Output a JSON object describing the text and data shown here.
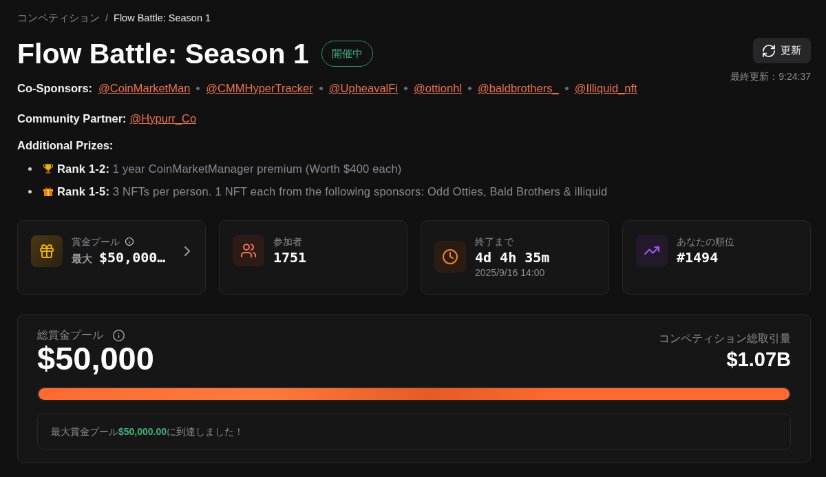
{
  "breadcrumb": {
    "parent": "コンペティション",
    "separator": "/",
    "current": "Flow Battle: Season 1"
  },
  "header": {
    "title": "Flow Battle: Season 1",
    "status": "開催中",
    "refresh_button": "更新",
    "last_updated": "最終更新：9:24:37"
  },
  "co_sponsors": {
    "label": "Co-Sponsors:",
    "links": [
      "@CoinMarketMan",
      "@CMMHyperTracker",
      "@UpheavalFi",
      "@ottionhl",
      "@baldbrothers_",
      "@Illiquid_nft"
    ]
  },
  "community_partner": {
    "label": "Community Partner:",
    "link": "@Hypurr_Co"
  },
  "additional_prizes": {
    "heading": "Additional Prizes:",
    "items": [
      {
        "kind": "trophy",
        "text": "**Rank 1-2:** 1 year CoinMarketManager premium (Worth $400 each)"
      },
      {
        "kind": "gift",
        "text": "**Rank 1-5:** 3 NFTs per person. 1 NFT each from the following sponsors: Odd Otties, Bald Brothers & illiquid"
      }
    ]
  },
  "stats": [
    {
      "kind": "prize_pool",
      "label": "賞金プール",
      "prefix": "最大",
      "value": "$50,000…"
    },
    {
      "kind": "participants",
      "label": "参加者",
      "value": "1751"
    },
    {
      "kind": "time_left",
      "label": "終了まで",
      "value": "4d 4h 35m",
      "sub": "2025/9/16 14:00"
    },
    {
      "kind": "rank",
      "label": "あなたの順位",
      "value": "#1494"
    }
  ],
  "total_pool": {
    "label": "総賞金プール",
    "amount": "$50,000",
    "volume_label": "コンペティション総取引量",
    "volume": "$1.07B",
    "progress": {
      "level": 1.0
    },
    "notice": "最大賞金プール**$50,000.00**に到達しました！"
  }
}
